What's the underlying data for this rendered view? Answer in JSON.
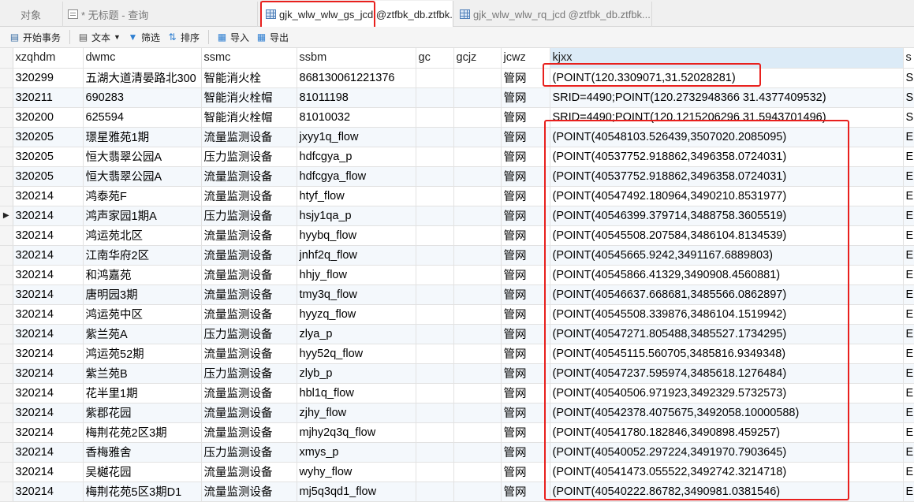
{
  "tabs": [
    {
      "label": "对象"
    },
    {
      "label": "* 无标题 - 查询"
    },
    {
      "label": "gjk_wlw_wlw_gs_jcd @ztfbk_db.ztfbk..."
    },
    {
      "label": "gjk_wlw_wlw_rq_jcd @ztfbk_db.ztfbk..."
    }
  ],
  "toolbar": {
    "begin_transaction": "开始事务",
    "text": "文本",
    "filter": "筛选",
    "sort": "排序",
    "import": "导入",
    "export": "导出"
  },
  "columns": [
    "xzqhdm",
    "dwmc",
    "ssmc",
    "ssbm",
    "gc",
    "gcjz",
    "jcwz",
    "kjxx",
    "s"
  ],
  "rows": [
    [
      "320299",
      "五湖大道清晏路北300",
      "智能消火栓",
      "868130061221376",
      "",
      "",
      "管网",
      "(POINT(120.3309071,31.52028281)",
      "S"
    ],
    [
      "320211",
      "690283",
      "智能消火栓帽",
      "81011198",
      "",
      "",
      "管网",
      "SRID=4490;POINT(120.2732948366 31.4377409532)",
      "S"
    ],
    [
      "320200",
      "625594",
      "智能消火栓帽",
      "81010032",
      "",
      "",
      "管网",
      "SRID=4490;POINT(120.1215206296 31.5943701496)",
      "S"
    ],
    [
      "320205",
      "璟星雅苑1期",
      "流量监测设备",
      "jxyy1q_flow",
      "",
      "",
      "管网",
      "(POINT(40548103.526439,3507020.2085095)",
      "E"
    ],
    [
      "320205",
      "恒大翡翠公园A",
      "压力监测设备",
      "hdfcgya_p",
      "",
      "",
      "管网",
      "(POINT(40537752.918862,3496358.0724031)",
      "E"
    ],
    [
      "320205",
      "恒大翡翠公园A",
      "流量监测设备",
      "hdfcgya_flow",
      "",
      "",
      "管网",
      "(POINT(40537752.918862,3496358.0724031)",
      "E"
    ],
    [
      "320214",
      "鸿泰苑F",
      "流量监测设备",
      "htyf_flow",
      "",
      "",
      "管网",
      "(POINT(40547492.180964,3490210.8531977)",
      "E"
    ],
    [
      "320214",
      "鸿声家园1期A",
      "压力监测设备",
      "hsjy1qa_p",
      "",
      "",
      "管网",
      "(POINT(40546399.379714,3488758.3605519)",
      "E"
    ],
    [
      "320214",
      "鸿运苑北区",
      "流量监测设备",
      "hyybq_flow",
      "",
      "",
      "管网",
      "(POINT(40545508.207584,3486104.8134539)",
      "E"
    ],
    [
      "320214",
      "江南华府2区",
      "流量监测设备",
      "jnhf2q_flow",
      "",
      "",
      "管网",
      "(POINT(40545665.9242,3491167.6889803)",
      "E"
    ],
    [
      "320214",
      "和鸿嘉苑",
      "流量监测设备",
      "hhjy_flow",
      "",
      "",
      "管网",
      "(POINT(40545866.41329,3490908.4560881)",
      "E"
    ],
    [
      "320214",
      "唐明园3期",
      "流量监测设备",
      "tmy3q_flow",
      "",
      "",
      "管网",
      "(POINT(40546637.668681,3485566.0862897)",
      "E"
    ],
    [
      "320214",
      "鸿运苑中区",
      "流量监测设备",
      "hyyzq_flow",
      "",
      "",
      "管网",
      "(POINT(40545508.339876,3486104.1519942)",
      "E"
    ],
    [
      "320214",
      "紫兰苑A",
      "压力监测设备",
      "zlya_p",
      "",
      "",
      "管网",
      "(POINT(40547271.805488,3485527.1734295)",
      "E"
    ],
    [
      "320214",
      "鸿运苑52期",
      "流量监测设备",
      "hyy52q_flow",
      "",
      "",
      "管网",
      "(POINT(40545115.560705,3485816.9349348)",
      "E"
    ],
    [
      "320214",
      "紫兰苑B",
      "压力监测设备",
      "zlyb_p",
      "",
      "",
      "管网",
      "(POINT(40547237.595974,3485618.1276484)",
      "E"
    ],
    [
      "320214",
      "花半里1期",
      "流量监测设备",
      "hbl1q_flow",
      "",
      "",
      "管网",
      "(POINT(40540506.971923,3492329.5732573)",
      "E"
    ],
    [
      "320214",
      "紫郡花园",
      "流量监测设备",
      "zjhy_flow",
      "",
      "",
      "管网",
      "(POINT(40542378.4075675,3492058.10000588)",
      "E"
    ],
    [
      "320214",
      "梅荆花苑2区3期",
      "流量监测设备",
      "mjhy2q3q_flow",
      "",
      "",
      "管网",
      "(POINT(40541780.182846,3490898.459257)",
      "E"
    ],
    [
      "320214",
      "香梅雅舍",
      "压力监测设备",
      "xmys_p",
      "",
      "",
      "管网",
      "(POINT(40540052.297224,3491970.7903645)",
      "E"
    ],
    [
      "320214",
      "吴樾花园",
      "流量监测设备",
      "wyhy_flow",
      "",
      "",
      "管网",
      "(POINT(40541473.055522,3492742.3214718)",
      "E"
    ],
    [
      "320214",
      "梅荆花苑5区3期D1",
      "流量监测设备",
      "mj5q3qd1_flow",
      "",
      "",
      "管网",
      "(POINT(40540222.86782,3490981.0381546)",
      "E"
    ]
  ],
  "current_row_index": 7,
  "colors": {
    "highlight_box": "#e8201d",
    "selected_header": "#dcebf7"
  }
}
